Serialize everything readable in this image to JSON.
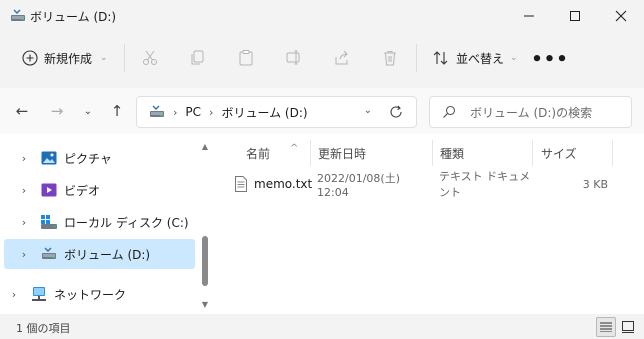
{
  "window": {
    "title": "ボリューム (D:)"
  },
  "toolbar": {
    "new_label": "新規作成",
    "sort_label": "並べ替え",
    "more_label": "•••"
  },
  "address": {
    "crumbs": [
      "PC",
      "ボリューム (D:)"
    ]
  },
  "search": {
    "placeholder": "ボリューム (D:)の検索"
  },
  "sidebar": {
    "items": [
      {
        "label": "ピクチャ"
      },
      {
        "label": "ビデオ"
      },
      {
        "label": "ローカル ディスク (C:)"
      },
      {
        "label": "ボリューム (D:)"
      },
      {
        "label": "ネットワーク"
      }
    ]
  },
  "filelist": {
    "columns": [
      "名前",
      "更新日時",
      "種類",
      "サイズ"
    ],
    "rows": [
      {
        "name": "memo.txt",
        "modified": "2022/01/08(土) 12:04",
        "type": "テキスト ドキュメント",
        "size": "3 KB"
      }
    ]
  },
  "status": {
    "item_count": "1 個の項目"
  },
  "colors": {
    "selection": "#cce8ff",
    "accent": "#0067c0"
  }
}
